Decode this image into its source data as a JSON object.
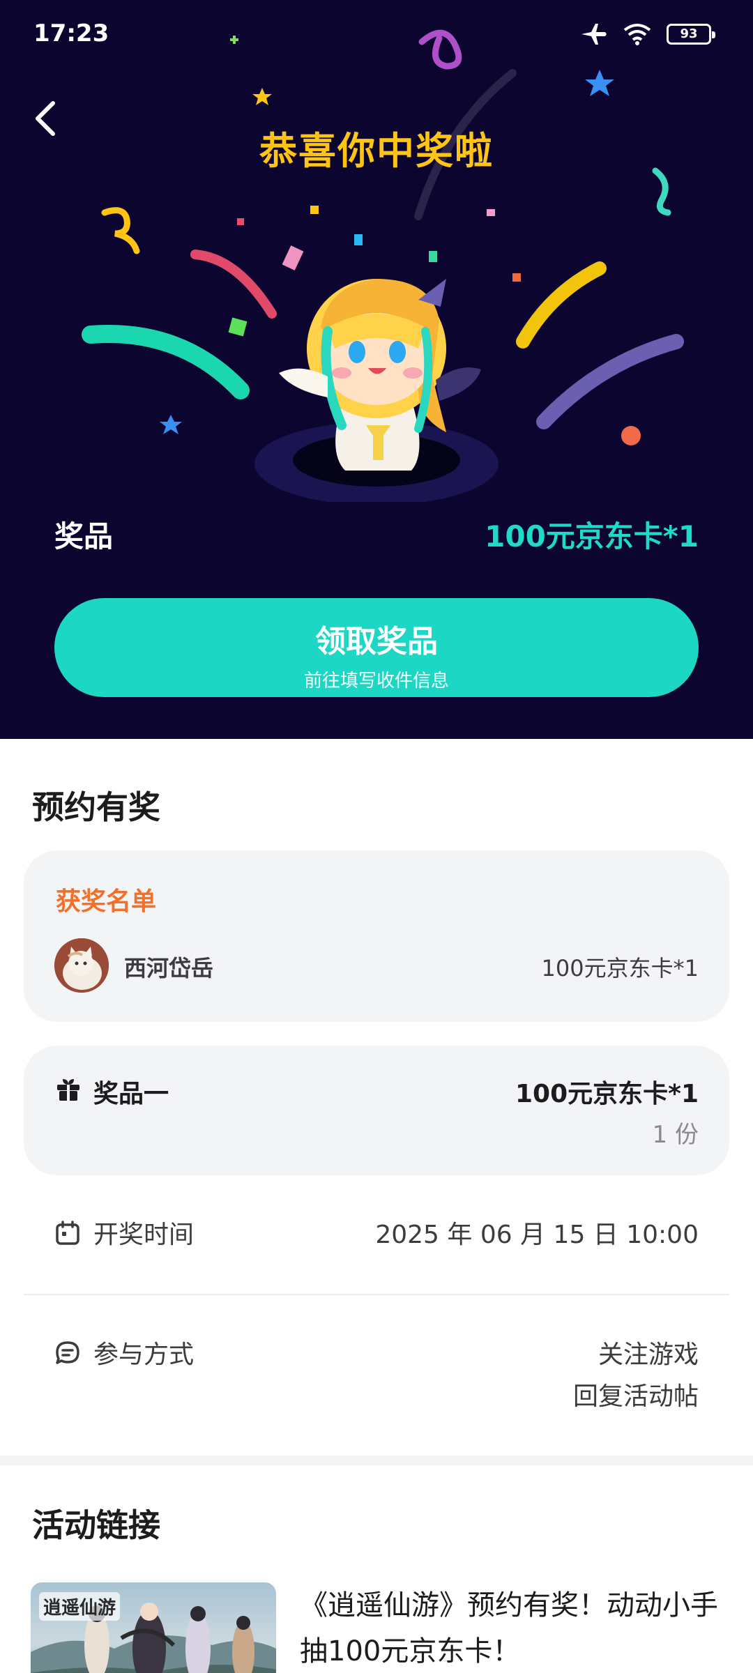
{
  "status_bar": {
    "time": "17:23",
    "battery": "93"
  },
  "hero": {
    "title": "恭喜你中奖啦",
    "prize_label": "奖品",
    "prize_value": "100元京东卡*1",
    "claim_button": {
      "label": "领取奖品",
      "sublabel": "前往填写收件信息"
    }
  },
  "reservation": {
    "section_title": "预约有奖",
    "winners": {
      "title": "获奖名单",
      "items": [
        {
          "name": "西河岱岳",
          "prize": "100元京东卡*1"
        }
      ]
    },
    "prize_item": {
      "label": "奖品一",
      "value": "100元京东卡*1",
      "count": "1 份"
    },
    "draw_time": {
      "label": "开奖时间",
      "value": "2025 年 06 月 15 日 10:00"
    },
    "participation": {
      "label": "参与方式",
      "methods": [
        "关注游戏",
        "回复活动帖"
      ]
    }
  },
  "activity_links": {
    "section_title": "活动链接",
    "items": [
      {
        "thumb_text": "逍遥仙游",
        "title": "《逍遥仙游》预约有奖！动动小手抽100元京东卡！"
      }
    ]
  },
  "colors": {
    "hero_bg": "#0c0530",
    "accent_teal": "#1bd7c4",
    "title_gold": "#ffc414",
    "winner_orange": "#f2712a"
  }
}
